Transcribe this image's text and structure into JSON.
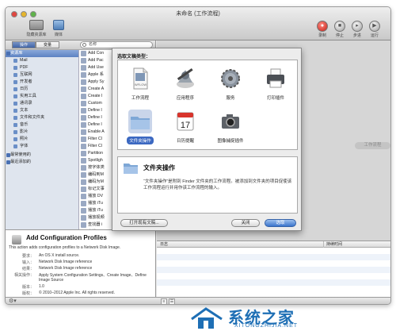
{
  "window": {
    "title": "未命名 (工作流程)",
    "toolbar": {
      "library_label": "隐藏资源库",
      "media_label": "媒体",
      "record_label": "录制",
      "stop_label": "停止",
      "step_label": "步进",
      "run_label": "运行"
    }
  },
  "library": {
    "segments": [
      "操作",
      "变量"
    ],
    "search_placeholder": "名称",
    "categories": [
      {
        "label": "资源库",
        "level": "top",
        "selected": true
      },
      {
        "label": "Mail",
        "level": "sub"
      },
      {
        "label": "PDF",
        "level": "sub"
      },
      {
        "label": "互联网",
        "level": "sub"
      },
      {
        "label": "开发者",
        "level": "sub"
      },
      {
        "label": "日历",
        "level": "sub"
      },
      {
        "label": "实用工具",
        "level": "sub"
      },
      {
        "label": "通讯录",
        "level": "sub"
      },
      {
        "label": "文本",
        "level": "sub"
      },
      {
        "label": "文件和文件夹",
        "level": "sub"
      },
      {
        "label": "音乐",
        "level": "sub"
      },
      {
        "label": "影片",
        "level": "sub"
      },
      {
        "label": "照片",
        "level": "sub"
      },
      {
        "label": "字体",
        "level": "sub"
      },
      {
        "label": "最常使用的",
        "level": "top",
        "gap": true
      },
      {
        "label": "最近添加的",
        "level": "top"
      }
    ],
    "actions": [
      "Add Con",
      "Add Pac",
      "Add Use",
      "Apple 系",
      "Apply Sy",
      "Create A",
      "Create I",
      "Custom",
      "Define I",
      "Define I",
      "Define I",
      "Enable A",
      "Filter Cl",
      "Filter Cl",
      "Partition",
      "Spotligh",
      "按字体类",
      "编码到M",
      "编码为M",
      "标记文事",
      "播放 DV",
      "播放 iTu",
      "播放 iTu",
      "播放视频",
      "查找器 i",
      "查找 Fin",
      "查找 iTu"
    ]
  },
  "description": {
    "title": "Add Configuration Profiles",
    "subtitle": "This action adds configuration profiles to a Network Disk Image.",
    "rows": [
      {
        "k": "要求：",
        "v": "An OS X install source."
      },
      {
        "k": "输入：",
        "v": "Network Disk Image reference"
      },
      {
        "k": "结果：",
        "v": "Network Disk Image reference"
      },
      {
        "k": "相关操作：",
        "v": "Apply System Configuration Settings、Create Image、Define Image Source"
      },
      {
        "k": "版本：",
        "v": "1.0"
      },
      {
        "k": "版权：",
        "v": "© 2010–2012 Apple Inc. All rights reserved."
      }
    ]
  },
  "workflow": {
    "drag_hint": "工作流程"
  },
  "log": {
    "col1": "日志",
    "col2": "持续时间"
  },
  "sheet": {
    "prompt": "选取文稿类型：",
    "types": [
      {
        "label": "工作流程",
        "icon": "workflow-icon",
        "selected": false
      },
      {
        "label": "应用程序",
        "icon": "application-icon",
        "selected": false
      },
      {
        "label": "服务",
        "icon": "service-icon",
        "selected": false
      },
      {
        "label": "打印插件",
        "icon": "printer-icon",
        "selected": false
      },
      {
        "label": "文件夹操作",
        "icon": "folder-icon",
        "selected": true
      },
      {
        "label": "日历提醒",
        "icon": "calendar-icon",
        "selected": false
      },
      {
        "label": "图像捕捉插件",
        "icon": "camera-icon",
        "selected": false
      }
    ],
    "calendar_day": "17",
    "selected_title": "文件夹操作",
    "selected_desc": "“文件夹操作”是附到 Finder 文件夹的工作流程。被添加到文件夹的项目促使该工作流程运行并用作该工作流程的输入。",
    "open_button": "打开现有文稿...",
    "close_button": "关闭",
    "choose_button": "选取"
  },
  "watermark": {
    "main": "系统之家",
    "sub": "XITONGZHIJIA.NET"
  },
  "colors": {
    "accent": "#3b68c1",
    "watermark": "#1e6fb5"
  }
}
